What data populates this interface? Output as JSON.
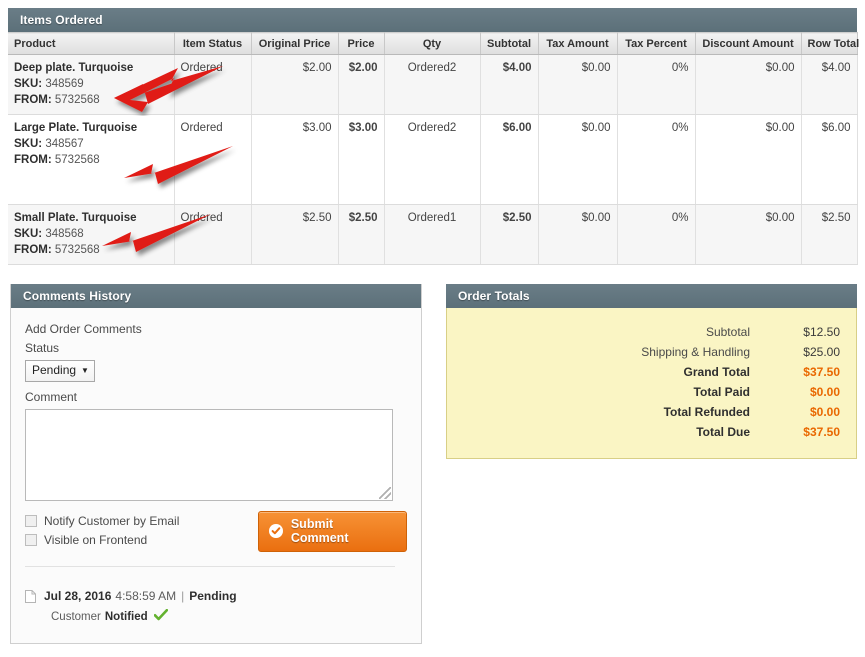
{
  "items_panel": {
    "title": "Items Ordered",
    "columns": [
      "Product",
      "Item Status",
      "Original Price",
      "Price",
      "Qty",
      "Subtotal",
      "Tax Amount",
      "Tax Percent",
      "Discount Amount",
      "Row Total"
    ],
    "rows": [
      {
        "product": "Deep plate. Turquoise",
        "sku_label": "SKU:",
        "sku": "348569",
        "from_label": "FROM:",
        "from": "5732568",
        "item_status": "Ordered",
        "original_price": "$2.00",
        "price": "$2.00",
        "qty_label": "Ordered",
        "qty": "2",
        "subtotal": "$4.00",
        "tax_amount": "$0.00",
        "tax_percent": "0%",
        "discount_amount": "$0.00",
        "row_total": "$4.00"
      },
      {
        "product": "Large Plate. Turquoise",
        "sku_label": "SKU:",
        "sku": "348567",
        "from_label": "FROM:",
        "from": "5732568",
        "item_status": "Ordered",
        "original_price": "$3.00",
        "price": "$3.00",
        "qty_label": "Ordered",
        "qty": "2",
        "subtotal": "$6.00",
        "tax_amount": "$0.00",
        "tax_percent": "0%",
        "discount_amount": "$0.00",
        "row_total": "$6.00"
      },
      {
        "product": "Small Plate. Turquoise",
        "sku_label": "SKU:",
        "sku": "348568",
        "from_label": "FROM:",
        "from": "5732568",
        "item_status": "Ordered",
        "original_price": "$2.50",
        "price": "$2.50",
        "qty_label": "Ordered",
        "qty": "1",
        "subtotal": "$2.50",
        "tax_amount": "$0.00",
        "tax_percent": "0%",
        "discount_amount": "$0.00",
        "row_total": "$2.50"
      }
    ]
  },
  "annotations": {
    "arrow_color": "#e01b16",
    "count": 3,
    "description": "red arrows pointing at the FROM field of each row"
  },
  "comments_panel": {
    "title": "Comments History",
    "add_comments_label": "Add Order Comments",
    "status_label": "Status",
    "status_value": "Pending",
    "comment_label": "Comment",
    "comment_value": "",
    "notify_label": "Notify Customer by Email",
    "notify_checked": false,
    "visible_label": "Visible on Frontend",
    "visible_checked": false,
    "submit_label": "Submit Comment",
    "history": [
      {
        "date": "Jul 28, 2016",
        "time": "4:58:59 AM",
        "separator": "|",
        "status": "Pending",
        "note_prefix": "Customer",
        "note_strong": "Notified"
      }
    ]
  },
  "totals_panel": {
    "title": "Order Totals",
    "rows": [
      {
        "label": "Subtotal",
        "value": "$12.50",
        "strong": false
      },
      {
        "label": "Shipping & Handling",
        "value": "$25.00",
        "strong": false
      },
      {
        "label": "Grand Total",
        "value": "$37.50",
        "strong": true
      },
      {
        "label": "Total Paid",
        "value": "$0.00",
        "strong": true
      },
      {
        "label": "Total Refunded",
        "value": "$0.00",
        "strong": true
      },
      {
        "label": "Total Due",
        "value": "$37.50",
        "strong": true
      }
    ]
  },
  "colors": {
    "panel_header": "#627680",
    "accent_orange": "#ea6f10",
    "totals_background": "#faf5c4",
    "arrow_red": "#e01b16",
    "check_green": "#63b22f"
  }
}
